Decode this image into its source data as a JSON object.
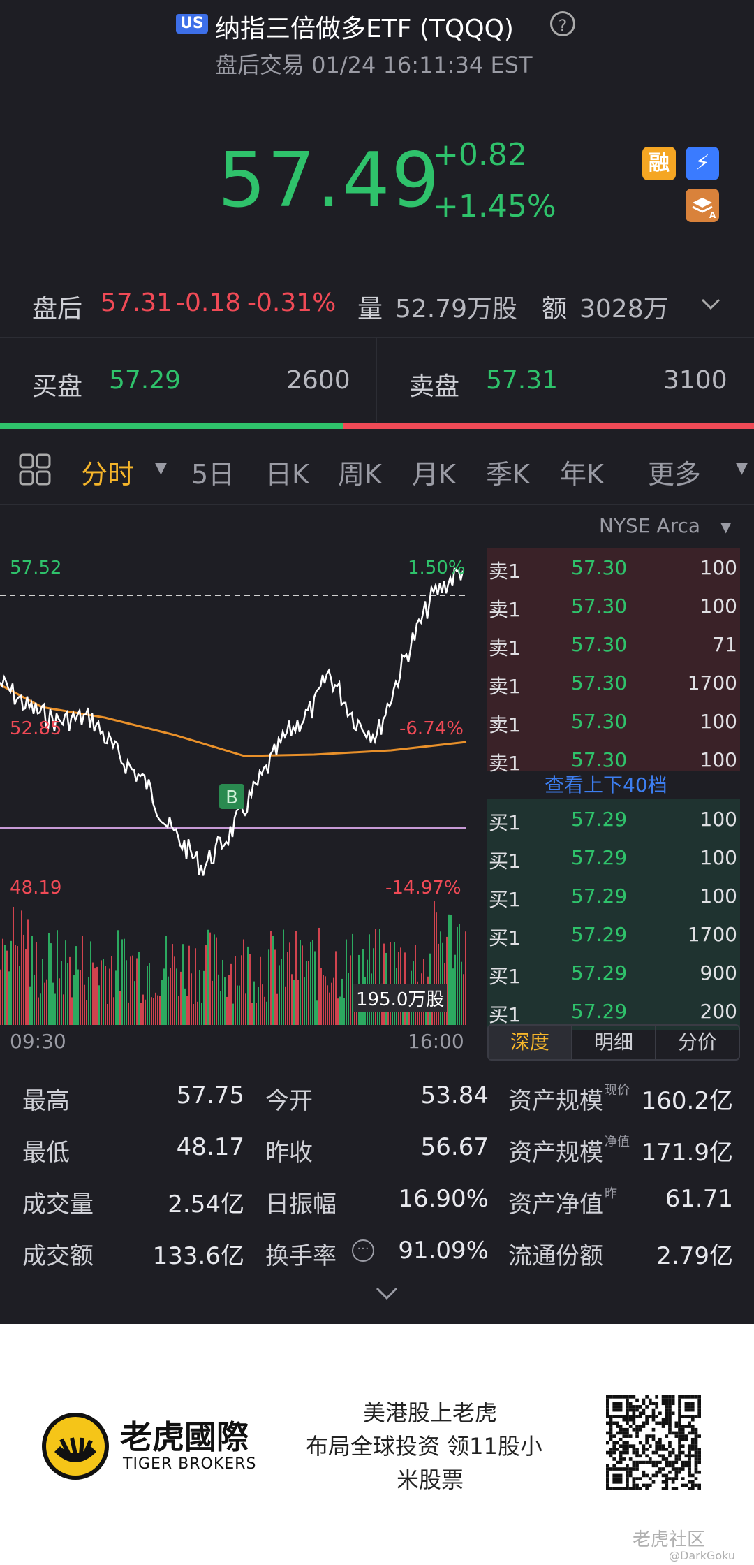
{
  "header": {
    "market_badge": "US",
    "title": "纳指三倍做多ETF (TQQQ)",
    "subtitle": "盘后交易 01/24 16:11:34 EST",
    "price": "57.49",
    "change": "+0.82",
    "change_pct": "+1.45%",
    "icons": {
      "margin": "融",
      "lightning": "⚡",
      "stack": "A"
    }
  },
  "after_hours": {
    "label": "盘后",
    "price": "57.31",
    "change": "-0.18",
    "change_pct": "-0.31%",
    "volume_label": "量",
    "volume": "52.79万股",
    "amount_label": "额",
    "amount": "3028万"
  },
  "bid_ask": {
    "bid_label": "买盘",
    "bid_price": "57.29",
    "bid_qty": "2600",
    "ask_label": "卖盘",
    "ask_price": "57.31",
    "ask_qty": "3100",
    "bid_ratio": 0.456
  },
  "tabs": [
    "分时",
    "5日",
    "日K",
    "周K",
    "月K",
    "季K",
    "年K",
    "更多"
  ],
  "chart": {
    "exchange": "NYSE Arca",
    "price_high": "57.52",
    "pct_high": "1.50%",
    "price_mid": "52.85",
    "pct_mid": "-6.74%",
    "price_low": "48.19",
    "pct_low": "-14.97%",
    "volume_badge": "195.0万股",
    "marker": "B",
    "time_start": "09:30",
    "time_end": "16:00"
  },
  "order_book": {
    "asks": [
      {
        "label": "卖1",
        "price": "57.30",
        "qty": "100"
      },
      {
        "label": "卖1",
        "price": "57.30",
        "qty": "100"
      },
      {
        "label": "卖1",
        "price": "57.30",
        "qty": "71"
      },
      {
        "label": "卖1",
        "price": "57.30",
        "qty": "1700"
      },
      {
        "label": "卖1",
        "price": "57.30",
        "qty": "100"
      },
      {
        "label": "卖1",
        "price": "57.30",
        "qty": "100"
      }
    ],
    "view_more": "查看上下40档",
    "bids": [
      {
        "label": "买1",
        "price": "57.29",
        "qty": "100"
      },
      {
        "label": "买1",
        "price": "57.29",
        "qty": "100"
      },
      {
        "label": "买1",
        "price": "57.29",
        "qty": "100"
      },
      {
        "label": "买1",
        "price": "57.29",
        "qty": "1700"
      },
      {
        "label": "买1",
        "price": "57.29",
        "qty": "900"
      },
      {
        "label": "买1",
        "price": "57.29",
        "qty": "200"
      }
    ],
    "tabs": [
      "深度",
      "明细",
      "分价"
    ]
  },
  "stats": [
    [
      {
        "label": "最高",
        "value": "57.75"
      },
      {
        "label": "今开",
        "value": "53.84"
      },
      {
        "label": "资产规模",
        "sup": "现价",
        "value": "160.2亿"
      }
    ],
    [
      {
        "label": "最低",
        "value": "48.17"
      },
      {
        "label": "昨收",
        "value": "56.67"
      },
      {
        "label": "资产规模",
        "sup": "净值",
        "value": "171.9亿"
      }
    ],
    [
      {
        "label": "成交量",
        "value": "2.54亿"
      },
      {
        "label": "日振幅",
        "value": "16.90%"
      },
      {
        "label": "资产净值",
        "sup": "昨",
        "value": "61.71"
      }
    ],
    [
      {
        "label": "成交额",
        "value": "133.6亿"
      },
      {
        "label": "换手率",
        "value": "91.09%"
      },
      {
        "label": "流通份额",
        "value": "2.79亿"
      }
    ]
  ],
  "footer": {
    "brand_cn": "老虎國際",
    "brand_en": "TIGER BROKERS",
    "slogan_line1": "美港股上老虎",
    "slogan_line2": "布局全球投资 领11股小",
    "slogan_line3": "米股票",
    "watermark": "老虎社区",
    "watermark_user": "@DarkGoku"
  },
  "colors": {
    "up": "#2fc26b",
    "down": "#f04a56",
    "accent": "#f5b52a",
    "background": "#1e1e24"
  }
}
